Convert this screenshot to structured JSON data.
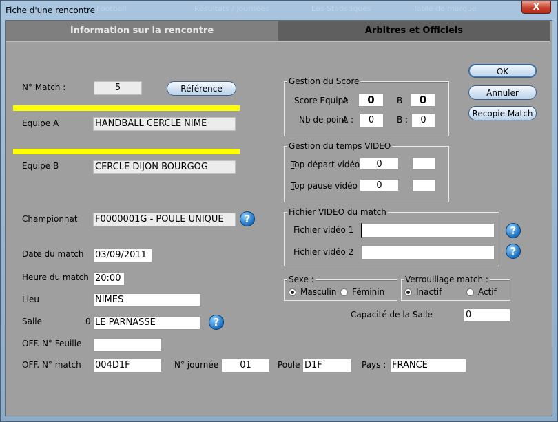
{
  "window": {
    "title": "Fiche d'une rencontre",
    "close_label": "X",
    "ghost": [
      "Football",
      "Résultats / journées",
      "Les Statistiques",
      "Table de marque"
    ]
  },
  "tabs": {
    "info": "Information sur la rencontre",
    "arbitres": "Arbitres et Officiels"
  },
  "match": {
    "label": "N° Match :",
    "value": "5",
    "reference_button": "Référence"
  },
  "equipe_a": {
    "label": "Equipe A",
    "value": "HANDBALL CERCLE NIME"
  },
  "equipe_b": {
    "label": "Equipe B",
    "value": "CERCLE DIJON BOURGOG"
  },
  "championnat": {
    "label": "Championnat",
    "value": "F0000001G - POULE UNIQUE"
  },
  "date": {
    "label": "Date du match",
    "value": "03/09/2011"
  },
  "heure": {
    "label": "Heure du match",
    "value": "20:00"
  },
  "lieu": {
    "label": "Lieu",
    "value": "NIMES"
  },
  "salle": {
    "label": "Salle",
    "prefix": "0",
    "value": "LE PARNASSE"
  },
  "off_feuille": {
    "label": "OFF. N° Feuille",
    "value": ""
  },
  "off_match": {
    "label": "OFF. N° match",
    "value": "004D1F"
  },
  "journee": {
    "label": "N° journée",
    "value": "01"
  },
  "poule": {
    "label": "Poule",
    "value": "D1F"
  },
  "pays": {
    "label": "Pays :",
    "value": "FRANCE"
  },
  "score": {
    "title": "Gestion du Score",
    "score_label": "Score Equipe",
    "a": "A",
    "b": "B",
    "score_a": "0",
    "score_b": "0",
    "point_label": "Nb de point",
    "a2": "A :",
    "b2": "B :",
    "point_a": "0",
    "point_b": "0"
  },
  "video_time": {
    "title": "Gestion du temps VIDEO",
    "start_label_t": "T",
    "start_label_rest": "op départ vidéo",
    "start_value": "0",
    "start_extra": "",
    "pause_label_t": "T",
    "pause_label_rest": "op pause vidéo",
    "pause_value": "0",
    "pause_extra": ""
  },
  "video_file": {
    "title": "Fichier VIDEO du match",
    "file1_label": "Fichier vidéo 1",
    "file1_value": "",
    "file2_label": "Fichier vidéo 2",
    "file2_value": ""
  },
  "sexe": {
    "title": "Sexe :",
    "masculin": "Masculin",
    "feminin": "Féminin",
    "selected": "Masculin"
  },
  "verrouillage": {
    "title": "Verrouillage match :",
    "inactif": "Inactif",
    "actif": "Actif",
    "selected": "Inactif"
  },
  "capacite": {
    "label": "Capacité de la Salle",
    "value": "0"
  },
  "buttons": {
    "ok": "OK",
    "annuler": "Annuler",
    "recopie": "Recopie Match"
  },
  "help_glyph": "?",
  "colors": {
    "highlight": "#ffff00",
    "panel": "#9f9f9f",
    "accent": "#1b6fc0"
  }
}
